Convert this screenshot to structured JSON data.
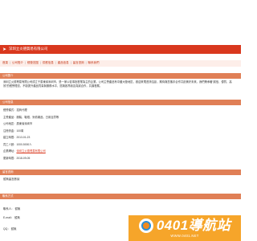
{
  "header": {
    "title": "深圳立炎德貿易有限公司"
  },
  "nav": {
    "items": [
      "首頁",
      "公司簡介",
      "經營范圍",
      "供應信息",
      "產品信息",
      "留言咨詢",
      "聯系我們"
    ],
    "separator": "|"
  },
  "sections": {
    "profile_title": "公司簡介",
    "profile_text": "深圳立炎德貿易有限公司成立于廣東省深圳市，是一家以從事批發業為主的企業。公司主營產品有中國大陸地區，歡迎來電咨詢洽談，期待與您攜手合作共創美好未來。我們秉承著“誠信、優質、高效”的經營理念，不斷提升產品質量與服務水平，愿與各界朋友真誠合作，共謀發展。",
    "info_title": "公司信息",
    "contact_title": "聯系方式",
    "message_title": "留言咨詢",
    "message_text": "暫無留言數據"
  },
  "info": [
    {
      "label": "經營模式：",
      "value": "招商代理",
      "link": false
    },
    {
      "label": "主營產品：",
      "value": "服裝、鞋帽、針紡織品、日用百貨等",
      "link": false
    },
    {
      "label": "公司地區：",
      "value": "廣東省深圳市",
      "link": false
    },
    {
      "label": "注冊資金：",
      "value": "100萬",
      "link": false
    },
    {
      "label": "建立時間：",
      "value": "2013-01-23",
      "link": false
    },
    {
      "label": "員工人數：",
      "value": "1000-5000人",
      "link": false
    },
    {
      "label": "企業網址：",
      "value": "深圳立炎德貿易有限公司",
      "link": true
    },
    {
      "label": "更新時間：",
      "value": "2018-09-05",
      "link": false
    }
  ],
  "contact": {
    "person": "聯系人：  暫無",
    "email": "E-mail：  暫無",
    "qq": "QQ：  暫無"
  },
  "watermark": {
    "title": "0401導航站",
    "subtitle": "WWW.0401.NET"
  },
  "colors": {
    "title_bar": "#d9381e",
    "nav_bg": "#fdeee9",
    "section_head": "#e07f56",
    "watermark_bg": "#f6a52a"
  }
}
